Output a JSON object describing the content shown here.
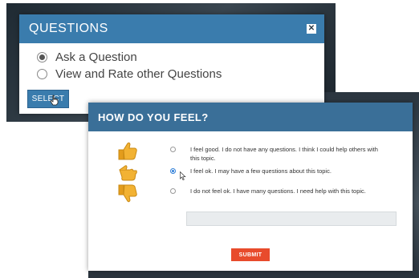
{
  "questions_dialog": {
    "title": "QUESTIONS",
    "close_icon": "close-icon",
    "options": [
      {
        "label": "Ask a Question",
        "selected": true
      },
      {
        "label": "View and Rate other Questions",
        "selected": false
      }
    ],
    "select_label": "SELECT"
  },
  "feel_dialog": {
    "title": "HOW DO YOU FEEL?",
    "options": [
      {
        "icon": "thumbs-up-icon",
        "label": "I feel good. I do not have any questions. I think I could help others with this topic.",
        "selected": false
      },
      {
        "icon": "thumbs-sideways-icon",
        "label": "I feel ok. I may have a few questions about this topic.",
        "selected": true
      },
      {
        "icon": "thumbs-down-icon",
        "label": "I do not feel ok. I have many questions. I need help with this topic.",
        "selected": false
      }
    ],
    "text_value": "",
    "submit_label": "SUBMIT"
  },
  "colors": {
    "header_blue": "#3a7cad",
    "submit_red": "#e84b2c",
    "thumb_yellow": "#f2b233"
  }
}
